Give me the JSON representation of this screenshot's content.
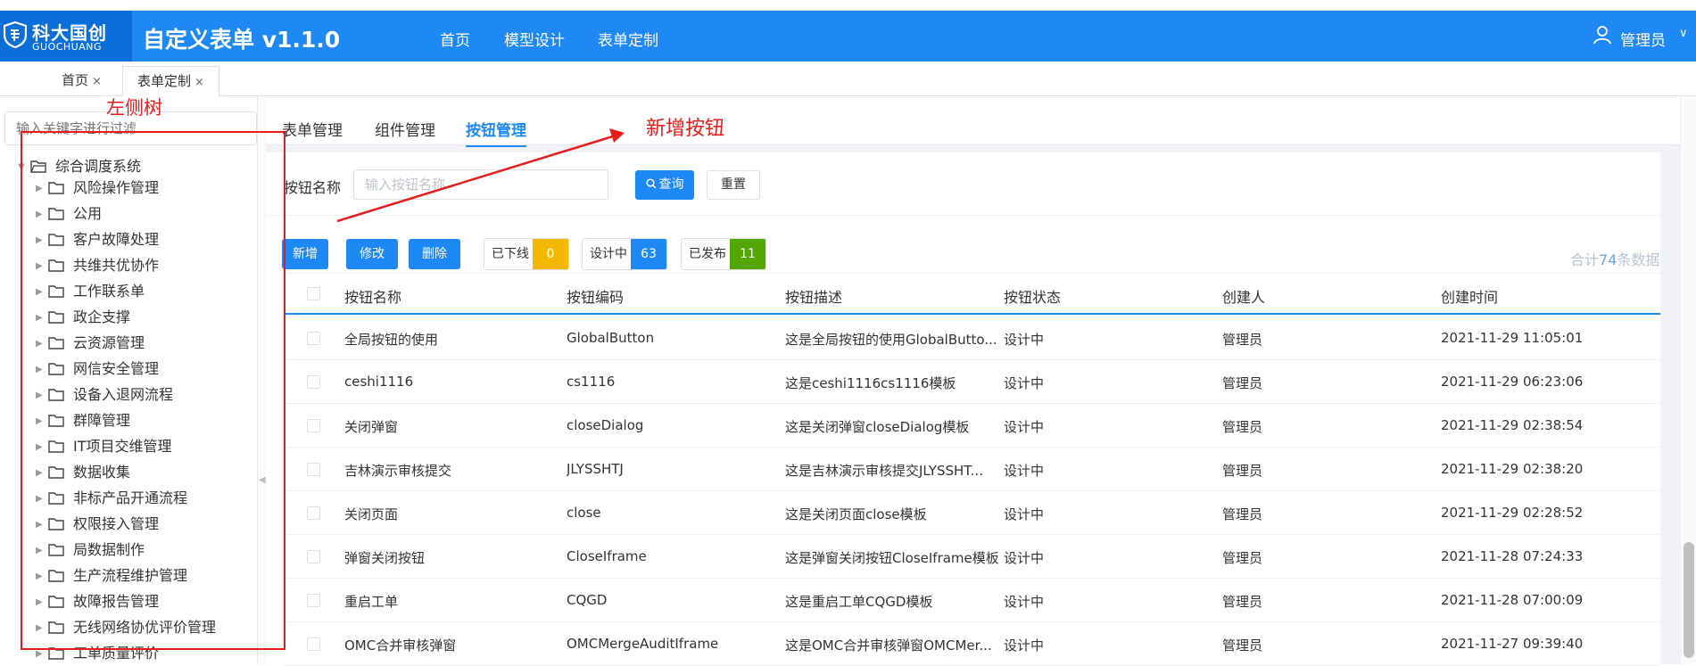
{
  "header": {
    "logo_cn": "科大国创",
    "logo_en": "GUOCHUANG",
    "app_title": "自定义表单 v1.1.0",
    "nav": [
      "首页",
      "模型设计",
      "表单定制"
    ],
    "user_name": "管理员",
    "user_caret": "∨",
    "color": "#1e88f5"
  },
  "page_tabs": [
    {
      "label": "首页",
      "close": "×"
    },
    {
      "label": "表单定制",
      "close": "×"
    }
  ],
  "tree": {
    "search_placeholder": "输入关键字进行过滤",
    "root": "综合调度系统",
    "items": [
      "风险操作管理",
      "公用",
      "客户故障处理",
      "共维共优协作",
      "工作联系单",
      "政企支撑",
      "云资源管理",
      "网信安全管理",
      "设备入退网流程",
      "群障管理",
      "IT项目交维管理",
      "数据收集",
      "非标产品开通流程",
      "权限接入管理",
      "局数据制作",
      "生产流程维护管理",
      "故障报告管理",
      "无线网络协优评价管理",
      "工单质量评价"
    ],
    "annotation": "左侧树"
  },
  "subtabs": [
    "表单管理",
    "组件管理",
    "按钮管理"
  ],
  "annotation_new": "新增按钮",
  "search": {
    "label": "按钮名称",
    "placeholder": "输入按钮名称",
    "query_label": "查询",
    "reset_label": "重置"
  },
  "toolbar": {
    "add": "新增",
    "edit": "修改",
    "delete": "删除"
  },
  "stats": [
    {
      "label": "已下线",
      "value": "0",
      "color": "#f5b800"
    },
    {
      "label": "设计中",
      "value": "63",
      "color": "#1e88f5"
    },
    {
      "label": "已发布",
      "value": "11",
      "color": "#52a800"
    }
  ],
  "total": {
    "prefix": "合计",
    "count": "74",
    "suffix": "条数据"
  },
  "table": {
    "columns": [
      "按钮名称",
      "按钮编码",
      "按钮描述",
      "按钮状态",
      "创建人",
      "创建时间"
    ],
    "rows": [
      [
        "全局按钮的使用",
        "GlobalButton",
        "这是全局按钮的使用GlobalButto...",
        "设计中",
        "管理员",
        "2021-11-29 11:05:01"
      ],
      [
        "ceshi1116",
        "cs1116",
        "这是ceshi1116cs1116模板",
        "设计中",
        "管理员",
        "2021-11-29 06:23:06"
      ],
      [
        "关闭弹窗",
        "closeDialog",
        "这是关闭弹窗closeDialog模板",
        "设计中",
        "管理员",
        "2021-11-29 02:38:54"
      ],
      [
        "吉林演示审核提交",
        "JLYSSHTJ",
        "这是吉林演示审核提交JLYSSHT...",
        "设计中",
        "管理员",
        "2021-11-29 02:38:20"
      ],
      [
        "关闭页面",
        "close",
        "这是关闭页面close模板",
        "设计中",
        "管理员",
        "2021-11-29 02:28:52"
      ],
      [
        "弹窗关闭按钮",
        "CloseIframe",
        "这是弹窗关闭按钮CloseIframe模板",
        "设计中",
        "管理员",
        "2021-11-28 07:24:33"
      ],
      [
        "重启工单",
        "CQGD",
        "这是重启工单CQGD模板",
        "设计中",
        "管理员",
        "2021-11-28 07:00:09"
      ],
      [
        "OMC合并审核弹窗",
        "OMCMergeAuditIframe",
        "这是OMC合并审核弹窗OMCMer...",
        "设计中",
        "管理员",
        "2021-11-27 09:39:40"
      ]
    ]
  }
}
